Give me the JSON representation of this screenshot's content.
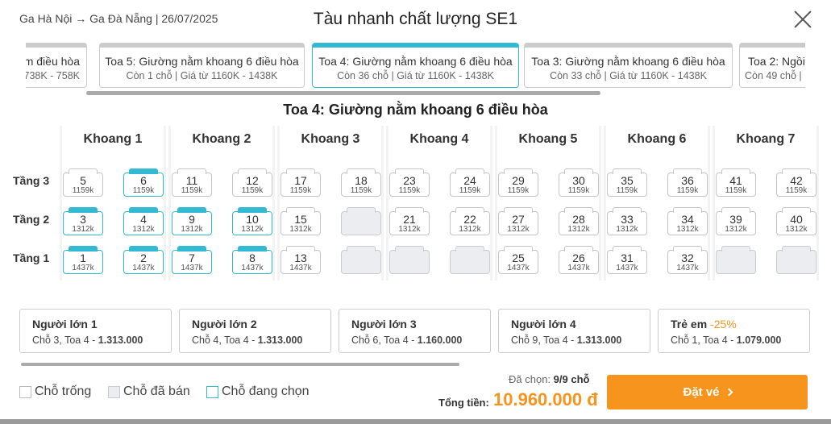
{
  "header": {
    "route": "Ga Hà Nội → Ga Đà Nẵng | 26/07/2025",
    "title": "Tàu nhanh chất lượng SE1"
  },
  "coaches": [
    {
      "name": "...ằm điều hòa",
      "info": "...từ 738K - 758K",
      "selected": false
    },
    {
      "name": "Toa 5: Giường nằm khoang 6 điều hòa",
      "info": "Còn 1 chỗ | Giá từ 1160K - 1438K",
      "selected": false
    },
    {
      "name": "Toa 4: Giường nằm khoang 6 điều hòa",
      "info": "Còn 36 chỗ | Giá từ 1160K - 1438K",
      "selected": true
    },
    {
      "name": "Toa 3: Giường nằm khoang 6 điều hòa",
      "info": "Còn 33 chỗ | Giá từ 1160K - 1438K",
      "selected": false
    },
    {
      "name": "Toa 2: Ngồi...",
      "info": "Còn 49 chỗ | ...",
      "selected": false
    }
  ],
  "coach_title": "Toa 4: Giường nằm khoang 6 điều hòa",
  "tiers": [
    "Tầng 3",
    "Tầng 2",
    "Tầng 1"
  ],
  "compartments": [
    {
      "label": "Khoang 1",
      "rows": [
        [
          {
            "n": "5",
            "p": "1159k",
            "s": "free"
          },
          {
            "n": "6",
            "p": "1159k",
            "s": "sel"
          }
        ],
        [
          {
            "n": "3",
            "p": "1312k",
            "s": "sel"
          },
          {
            "n": "4",
            "p": "1312k",
            "s": "sel"
          }
        ],
        [
          {
            "n": "1",
            "p": "1437k",
            "s": "sel"
          },
          {
            "n": "2",
            "p": "1437k",
            "s": "sel"
          }
        ]
      ]
    },
    {
      "label": "Khoang 2",
      "rows": [
        [
          {
            "n": "11",
            "p": "1159k",
            "s": "free"
          },
          {
            "n": "12",
            "p": "1159k",
            "s": "free"
          }
        ],
        [
          {
            "n": "9",
            "p": "1312k",
            "s": "sel"
          },
          {
            "n": "10",
            "p": "1312k",
            "s": "sel"
          }
        ],
        [
          {
            "n": "7",
            "p": "1437k",
            "s": "sel"
          },
          {
            "n": "8",
            "p": "1437k",
            "s": "sel"
          }
        ]
      ]
    },
    {
      "label": "Khoang 3",
      "rows": [
        [
          {
            "n": "17",
            "p": "1159k",
            "s": "free"
          },
          {
            "n": "18",
            "p": "1159k",
            "s": "free"
          }
        ],
        [
          {
            "n": "15",
            "p": "1312k",
            "s": "free"
          },
          {
            "n": "",
            "p": "",
            "s": "sold"
          }
        ],
        [
          {
            "n": "13",
            "p": "1437k",
            "s": "free"
          },
          {
            "n": "",
            "p": "",
            "s": "sold"
          }
        ]
      ]
    },
    {
      "label": "Khoang 4",
      "rows": [
        [
          {
            "n": "23",
            "p": "1159k",
            "s": "free"
          },
          {
            "n": "24",
            "p": "1159k",
            "s": "free"
          }
        ],
        [
          {
            "n": "21",
            "p": "1312k",
            "s": "free"
          },
          {
            "n": "22",
            "p": "1312k",
            "s": "free"
          }
        ],
        [
          {
            "n": "",
            "p": "",
            "s": "sold"
          },
          {
            "n": "",
            "p": "",
            "s": "sold"
          }
        ]
      ]
    },
    {
      "label": "Khoang 5",
      "rows": [
        [
          {
            "n": "29",
            "p": "1159k",
            "s": "free"
          },
          {
            "n": "30",
            "p": "1159k",
            "s": "free"
          }
        ],
        [
          {
            "n": "27",
            "p": "1312k",
            "s": "free"
          },
          {
            "n": "28",
            "p": "1312k",
            "s": "free"
          }
        ],
        [
          {
            "n": "25",
            "p": "1437k",
            "s": "free"
          },
          {
            "n": "26",
            "p": "1437k",
            "s": "free"
          }
        ]
      ]
    },
    {
      "label": "Khoang 6",
      "rows": [
        [
          {
            "n": "35",
            "p": "1159k",
            "s": "free"
          },
          {
            "n": "36",
            "p": "1159k",
            "s": "free"
          }
        ],
        [
          {
            "n": "33",
            "p": "1312k",
            "s": "free"
          },
          {
            "n": "34",
            "p": "1312k",
            "s": "free"
          }
        ],
        [
          {
            "n": "31",
            "p": "1437k",
            "s": "free"
          },
          {
            "n": "32",
            "p": "1437k",
            "s": "free"
          }
        ]
      ]
    },
    {
      "label": "Khoang 7",
      "rows": [
        [
          {
            "n": "41",
            "p": "1159k",
            "s": "free"
          },
          {
            "n": "42",
            "p": "1159k",
            "s": "free"
          }
        ],
        [
          {
            "n": "39",
            "p": "1312k",
            "s": "free"
          },
          {
            "n": "40",
            "p": "1312k",
            "s": "free"
          }
        ],
        [
          {
            "n": "",
            "p": "",
            "s": "sold"
          },
          {
            "n": "",
            "p": "",
            "s": "sold"
          }
        ]
      ]
    }
  ],
  "passengers": [
    {
      "name": "Người lớn 1",
      "discount": "",
      "detail": "Chỗ 3, Toa 4 - ",
      "price": "1.313.000"
    },
    {
      "name": "Người lớn 2",
      "discount": "",
      "detail": "Chỗ 4, Toa 4 - ",
      "price": "1.313.000"
    },
    {
      "name": "Người lớn 3",
      "discount": "",
      "detail": "Chỗ 6, Toa 4 - ",
      "price": "1.160.000"
    },
    {
      "name": "Người lớn 4",
      "discount": "",
      "detail": "Chỗ 9, Toa 4 - ",
      "price": "1.313.000"
    },
    {
      "name": "Trẻ em",
      "discount": "-25%",
      "detail": "Chỗ 1, Toa 4 - ",
      "price": "1.079.000"
    }
  ],
  "legend": {
    "free": "Chỗ trống",
    "sold": "Chỗ đã bán",
    "selected": "Chỗ đang chọn"
  },
  "summary": {
    "chosen_label": "Đã chọn:",
    "chosen_value": "9/9 chỗ",
    "total_label": "Tổng tiền:",
    "total_value": "10.960.000 đ",
    "book_label": "Đặt vé"
  },
  "colors": {
    "accent": "#34b9d3",
    "brand": "#f7941d",
    "sold": "#ebedf0"
  }
}
